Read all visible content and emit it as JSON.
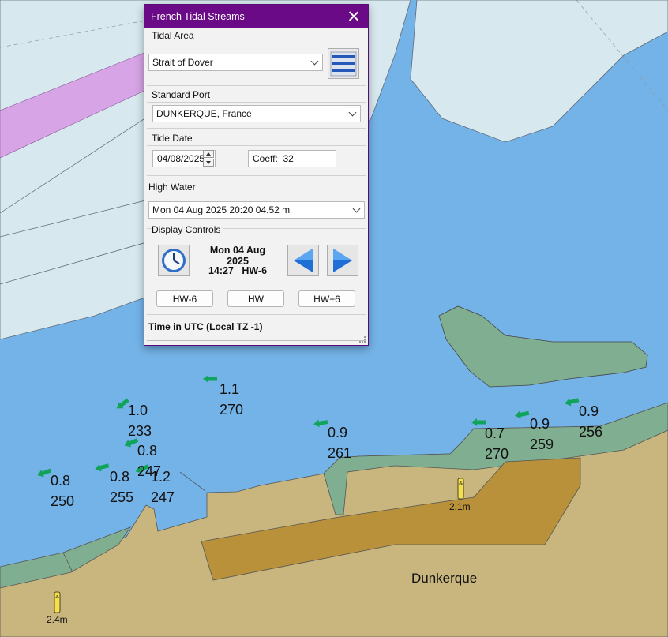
{
  "dialog": {
    "title": "French Tidal Streams",
    "tidal_area": {
      "label": "Tidal Area",
      "value": "Strait of Dover"
    },
    "standard_port": {
      "label": "Standard Port",
      "value": "DUNKERQUE, France"
    },
    "tide_date": {
      "label": "Tide Date",
      "date": "04/08/2025",
      "coeff_label": "Coeff:",
      "coeff_value": "32"
    },
    "high_water": {
      "label": "High Water",
      "value": "Mon 04 Aug 2025  20:20  04.52 m"
    },
    "display_controls": {
      "label": "Display Controls",
      "date_line": "Mon 04 Aug 2025",
      "time_line": "14:27",
      "hw_line": "HW-6",
      "buttons": [
        "HW-6",
        "HW",
        "HW+6"
      ]
    },
    "footer": "Time in UTC  (Local TZ -1)"
  },
  "map": {
    "colors": {
      "sea_deep": "#74b3e8",
      "sea_shallow": "#d7e9ee",
      "land": "#c8b67e",
      "intertidal": "#7fae91",
      "built_up": "#b8913a",
      "traffic_lane": "#d7a4e6",
      "arrow": "#12a35a"
    },
    "streams": [
      {
        "speed": "1.1",
        "direction": "270"
      },
      {
        "speed": "1.0",
        "direction": "233"
      },
      {
        "speed": "0.8",
        "direction": "247"
      },
      {
        "speed": "0.8",
        "direction": "250"
      },
      {
        "speed": "0.8",
        "direction": "255"
      },
      {
        "speed": "1.2",
        "direction": "247"
      },
      {
        "speed": "0.9",
        "direction": "261"
      },
      {
        "speed": "0.7",
        "direction": "270"
      },
      {
        "speed": "0.9",
        "direction": "259"
      },
      {
        "speed": "0.9",
        "direction": "256"
      }
    ],
    "depth_markers": [
      "2.1m",
      "2.4m"
    ],
    "place": "Dunkerque"
  }
}
